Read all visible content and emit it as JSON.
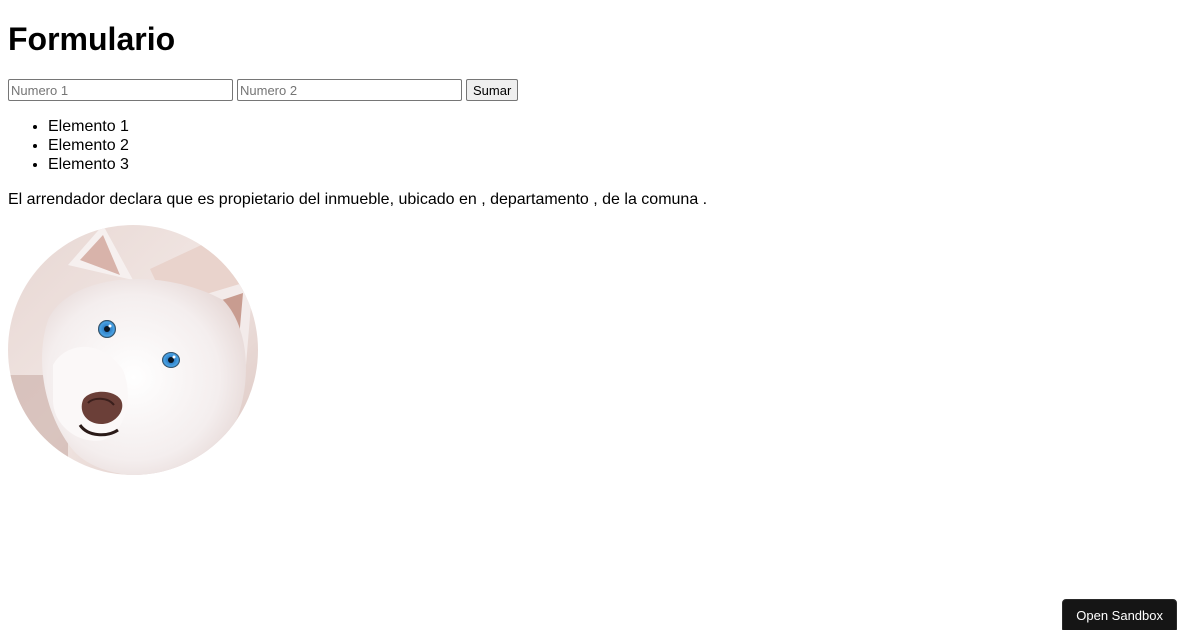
{
  "page": {
    "title": "Formulario"
  },
  "form": {
    "input1_placeholder": "Numero 1",
    "input1_value": "",
    "input2_placeholder": "Numero 2",
    "input2_value": "",
    "submit_label": "Sumar"
  },
  "list": {
    "items": [
      "Elemento 1",
      "Elemento 2",
      "Elemento 3"
    ]
  },
  "contract": {
    "text": "El arrendador declara que es propietario del inmueble, ubicado en , departamento , de la comuna ."
  },
  "image": {
    "subject": "white husky dog with blue eyes"
  },
  "sandbox": {
    "button_label": "Open Sandbox",
    "bg_color": "#151515",
    "text_color": "#ffffff"
  }
}
